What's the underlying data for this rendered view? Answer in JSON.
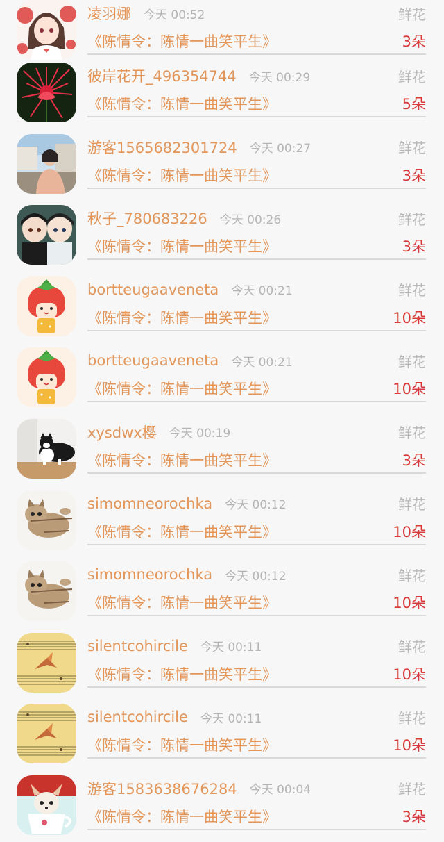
{
  "records": [
    {
      "username": "凌羽娜",
      "time": "今天 00:52",
      "gift": "鲜花",
      "title": "《陈情令：陈情一曲笑平生》",
      "count": "3朵",
      "avatar": "anime-girl-avatar"
    },
    {
      "username": "彼岸花开_496354744",
      "time": "今天 00:29",
      "gift": "鲜花",
      "title": "《陈情令：陈情一曲笑平生》",
      "count": "5朵",
      "avatar": "red-spider-lily-avatar"
    },
    {
      "username": "游客1565682301724",
      "time": "今天 00:27",
      "gift": "鲜花",
      "title": "《陈情令：陈情一曲笑平生》",
      "count": "3朵",
      "avatar": "woman-photo-avatar"
    },
    {
      "username": "秋子_780683226",
      "time": "今天 00:26",
      "gift": "鲜花",
      "title": "《陈情令：陈情一曲笑平生》",
      "count": "3朵",
      "avatar": "figurines-avatar"
    },
    {
      "username": "bortteugaaveneta",
      "time": "今天 00:21",
      "gift": "鲜花",
      "title": "《陈情令：陈情一曲笑平生》",
      "count": "10朵",
      "avatar": "strawberry-character-avatar"
    },
    {
      "username": "bortteugaaveneta",
      "time": "今天 00:21",
      "gift": "鲜花",
      "title": "《陈情令：陈情一曲笑平生》",
      "count": "10朵",
      "avatar": "strawberry-character-avatar"
    },
    {
      "username": "xysdwx樱",
      "time": "今天 00:19",
      "gift": "鲜花",
      "title": "《陈情令：陈情一曲笑平生》",
      "count": "3朵",
      "avatar": "cat-avatar"
    },
    {
      "username": "simomneorochka",
      "time": "今天 00:12",
      "gift": "鲜花",
      "title": "《陈情令：陈情一曲笑平生》",
      "count": "10朵",
      "avatar": "kitten-avatar"
    },
    {
      "username": "simomneorochka",
      "time": "今天 00:12",
      "gift": "鲜花",
      "title": "《陈情令：陈情一曲笑平生》",
      "count": "10朵",
      "avatar": "kitten-avatar"
    },
    {
      "username": "silentcohircile",
      "time": "今天 00:11",
      "gift": "鲜花",
      "title": "《陈情令：陈情一曲笑平生》",
      "count": "10朵",
      "avatar": "sheet-music-crane-avatar"
    },
    {
      "username": "silentcohircile",
      "time": "今天 00:11",
      "gift": "鲜花",
      "title": "《陈情令：陈情一曲笑平生》",
      "count": "10朵",
      "avatar": "sheet-music-crane-avatar"
    },
    {
      "username": "游客1583638676284",
      "time": "今天 00:04",
      "gift": "鲜花",
      "title": "《陈情令：陈情一曲笑平生》",
      "count": "3朵",
      "avatar": "puppy-teacup-avatar"
    }
  ]
}
